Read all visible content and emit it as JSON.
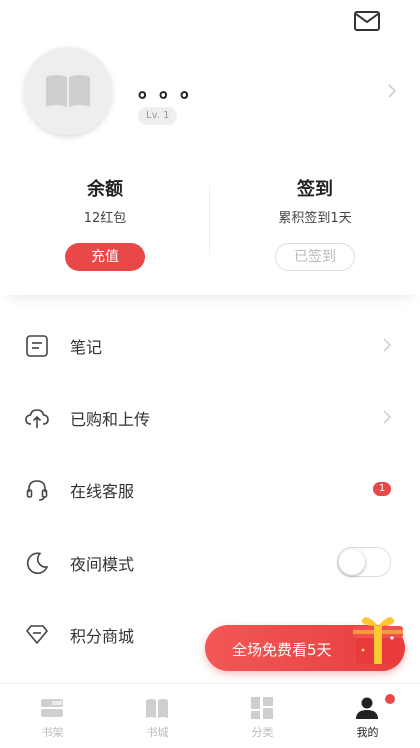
{
  "header": {
    "message_icon": "mail-icon"
  },
  "profile": {
    "avatar_icon": "book-icon",
    "username": "。。。",
    "level": "Lv. 1"
  },
  "stats": {
    "balance": {
      "title": "余额",
      "sub": "12红包",
      "button": "充值"
    },
    "checkin": {
      "title": "签到",
      "sub": "累积签到1天",
      "button": "已签到"
    }
  },
  "menu": {
    "items": [
      {
        "label": "笔记",
        "icon": "note-icon",
        "trailing": "chevron"
      },
      {
        "label": "已购和上传",
        "icon": "cloud-upload-icon",
        "trailing": "chevron"
      },
      {
        "label": "在线客服",
        "icon": "headset-icon",
        "trailing": "badge",
        "badge": "1"
      },
      {
        "label": "夜间模式",
        "icon": "moon-icon",
        "trailing": "toggle",
        "toggle_on": false
      },
      {
        "label": "积分商城",
        "icon": "diamond-icon",
        "trailing": "none"
      }
    ]
  },
  "promo": {
    "text": "全场免费看5天",
    "icon": "gift-icon"
  },
  "tabbar": {
    "tabs": [
      {
        "label": "书架",
        "icon": "bookshelf-icon",
        "active": false
      },
      {
        "label": "书城",
        "icon": "book-open-icon",
        "active": false
      },
      {
        "label": "分类",
        "icon": "category-icon",
        "active": false
      },
      {
        "label": "我的",
        "icon": "user-icon",
        "active": true,
        "dot": true
      }
    ]
  },
  "colors": {
    "accent": "#e84848",
    "muted": "#bbbbbb",
    "text": "#222222"
  }
}
